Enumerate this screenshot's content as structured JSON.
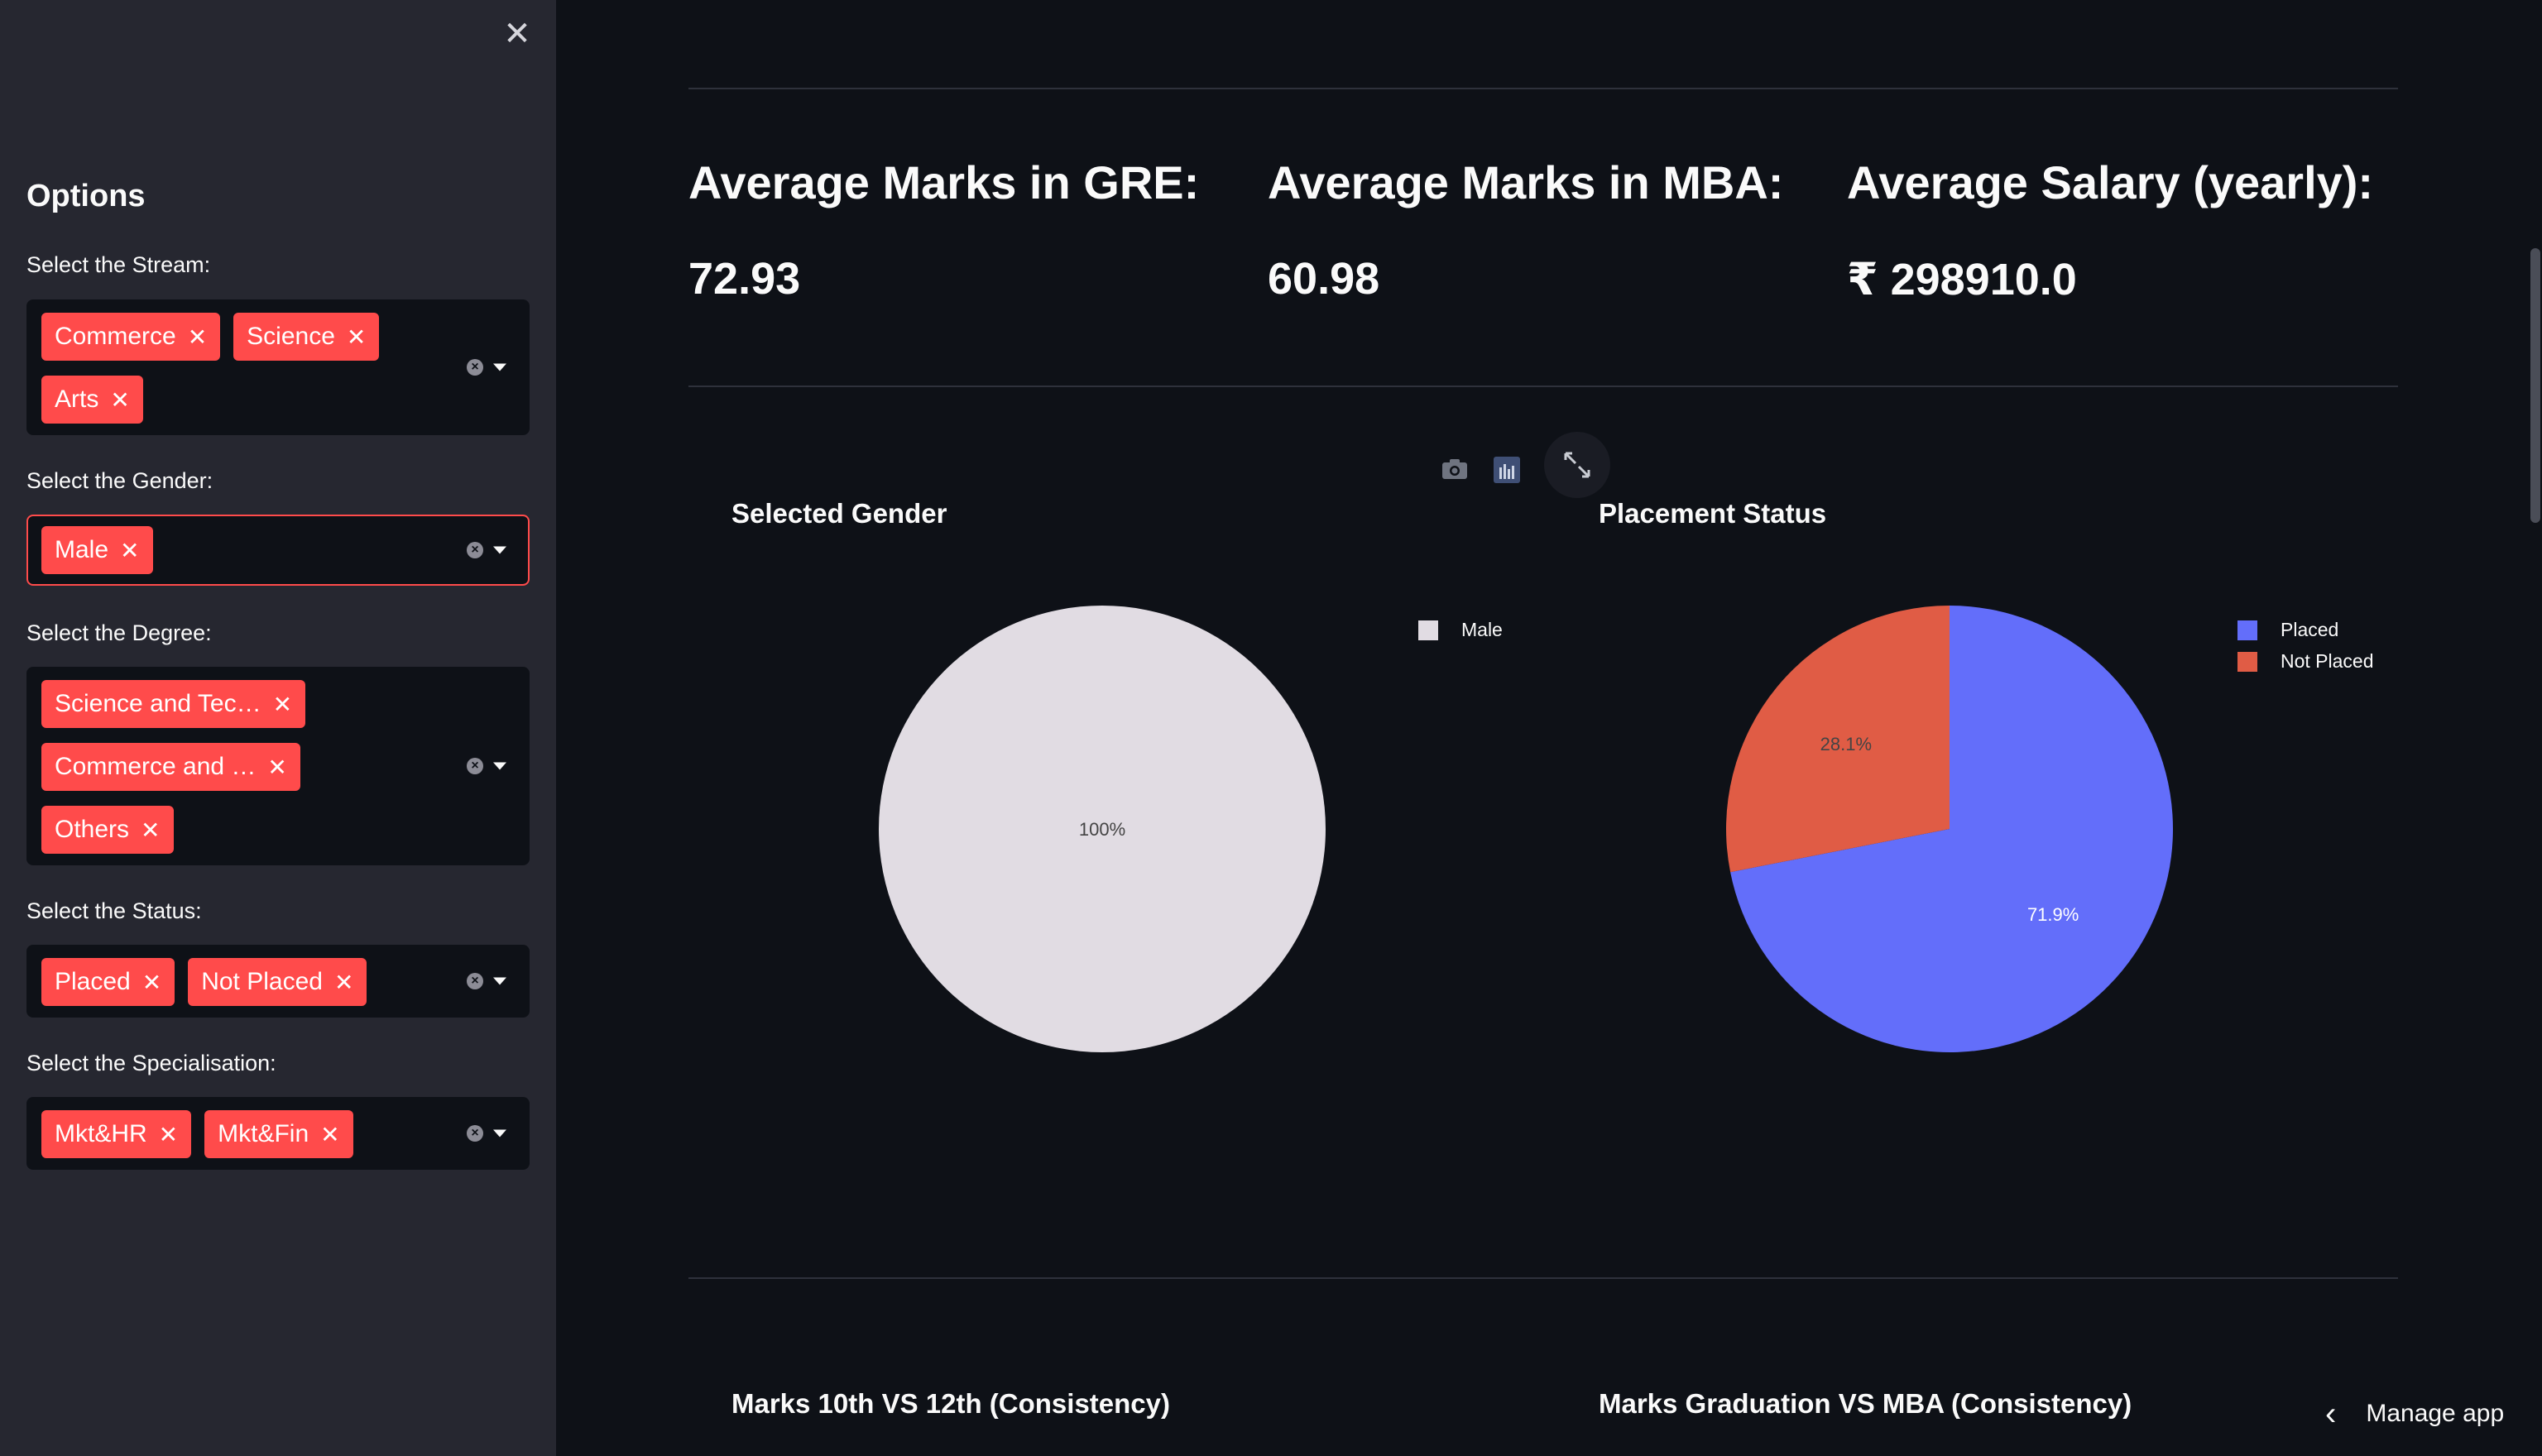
{
  "sidebar": {
    "close_icon": "close-icon",
    "title": "Options",
    "filters": [
      {
        "label": "Select the Stream:",
        "chips": [
          "Commerce",
          "Science",
          "Arts"
        ]
      },
      {
        "label": "Select the Gender:",
        "chips": [
          "Male"
        ]
      },
      {
        "label": "Select the Degree:",
        "chips": [
          "Science and Tec…",
          "Commerce and …",
          "Others"
        ]
      },
      {
        "label": "Select the Status:",
        "chips": [
          "Placed",
          "Not Placed"
        ]
      },
      {
        "label": "Select the Specialisation:",
        "chips": [
          "Mkt&HR",
          "Mkt&Fin"
        ]
      }
    ],
    "chip_remove_glyph": "✕",
    "clear_glyph": "×"
  },
  "metrics": [
    {
      "label": "Average Marks in GRE:",
      "value": "72.93"
    },
    {
      "label": "Average Marks in MBA:",
      "value": "60.98"
    },
    {
      "label": "Average Salary (yearly):",
      "value": "₹ 298910.0"
    }
  ],
  "modebar": [
    "camera-icon",
    "bar-chart-icon",
    "fullscreen-icon"
  ],
  "colors": {
    "accent": "#ff4b4b",
    "background": "#0e1117",
    "sidebar": "#262730",
    "male": "#e1dce3",
    "placed": "#636efa",
    "not_placed": "#e05c45"
  },
  "chart_data": [
    {
      "type": "pie",
      "title": "Selected Gender",
      "labels": [
        "Male"
      ],
      "values": [
        100
      ],
      "text_labels": [
        "100%"
      ]
    },
    {
      "type": "pie",
      "title": "Placement Status",
      "labels": [
        "Placed",
        "Not Placed"
      ],
      "values": [
        71.9,
        28.1
      ],
      "text_labels": [
        "71.9%",
        "28.1%"
      ]
    }
  ],
  "lower_charts": {
    "left_title": "Marks 10th VS 12th (Consistency)",
    "right_title": "Marks Graduation VS MBA (Consistency)"
  },
  "manage_app": {
    "label": "Manage app",
    "icon": "chevron-left-icon"
  }
}
